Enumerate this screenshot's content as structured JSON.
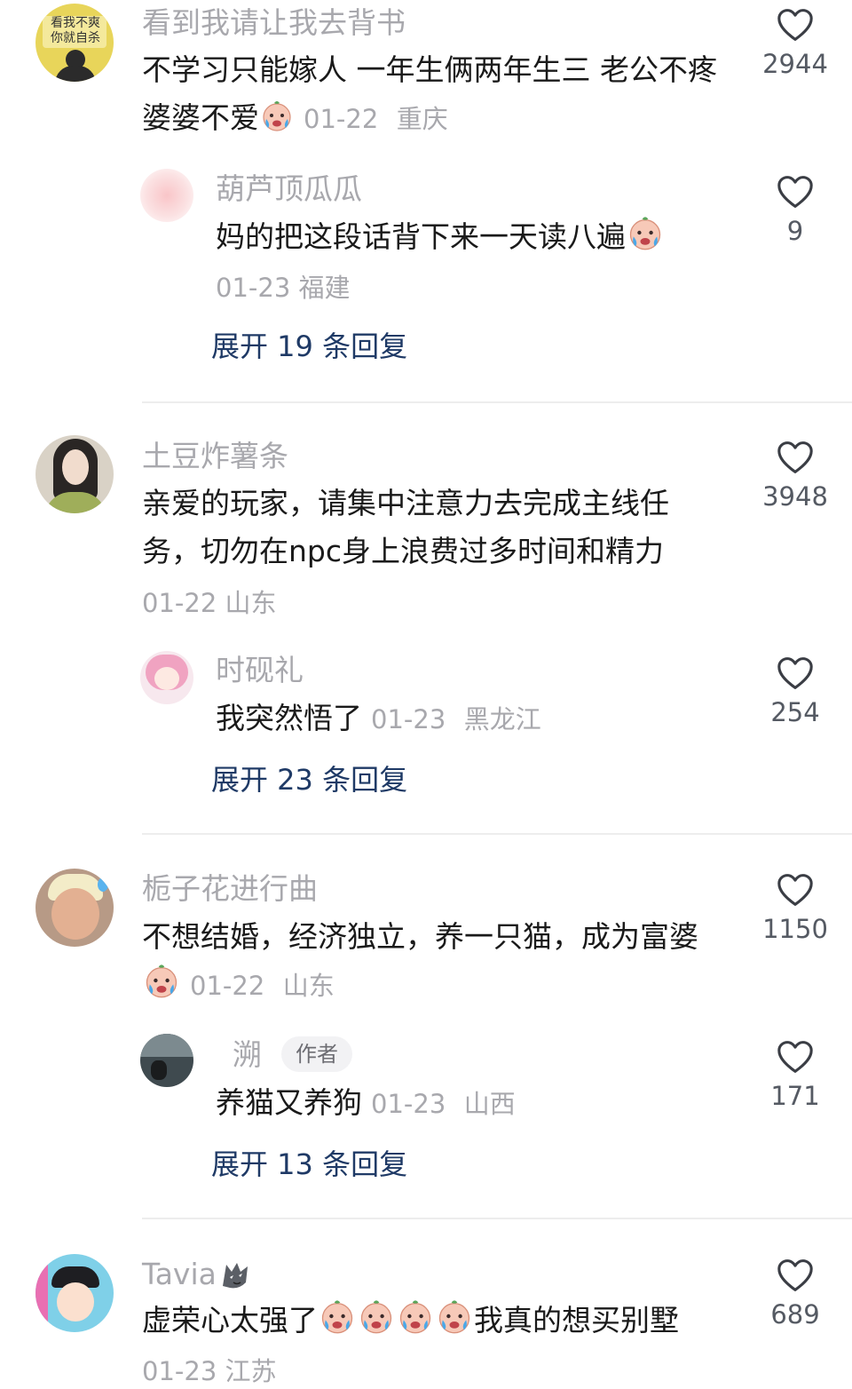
{
  "comments": [
    {
      "user": "看到我请让我去背书",
      "avatar_text": [
        "看我不爽",
        "你就自杀"
      ],
      "text": "不学习只能嫁人 一年生俩两年生三 老公不疼婆婆不爱",
      "date": "01-22",
      "location": "重庆",
      "likes": "2944",
      "reply": {
        "user": "葫芦顶瓜瓜",
        "text": "妈的把这段话背下来一天读八遍",
        "date": "01-23",
        "location": "福建",
        "likes": "9"
      },
      "expand": "展开 19 条回复"
    },
    {
      "user": "土豆炸薯条",
      "text": "亲爱的玩家，请集中注意力去完成主线任务，切勿在npc身上浪费过多时间和精力",
      "date": "01-22",
      "location": "山东",
      "likes": "3948",
      "reply": {
        "user": "时砚礼",
        "text": "我突然悟了",
        "date": "01-23",
        "location": "黑龙江",
        "likes": "254"
      },
      "expand": "展开 23 条回复"
    },
    {
      "user": "栀子花进行曲",
      "text": "不想结婚，经济独立，养一只猫，成为富婆",
      "date": "01-22",
      "location": "山东",
      "likes": "1150",
      "reply": {
        "user": "溯",
        "badge": "作者",
        "text": "养猫又养狗",
        "date": "01-23",
        "location": "山西",
        "likes": "171"
      },
      "expand": "展开 13 条回复"
    },
    {
      "user": "Tavia",
      "text_a": "虚荣心太强了",
      "text_b": "我真的想买别墅",
      "date": "01-23",
      "location": "江苏",
      "likes": "689"
    }
  ],
  "icons": {
    "like": "heart-outline-icon",
    "crying_emoji": "crying-emoji-icon",
    "wolf": "wolf-icon"
  },
  "colors": {
    "username": "#a8a8ad",
    "text": "#1a1a1a",
    "expand_link": "#1f3a66",
    "like_count": "#555a63"
  }
}
